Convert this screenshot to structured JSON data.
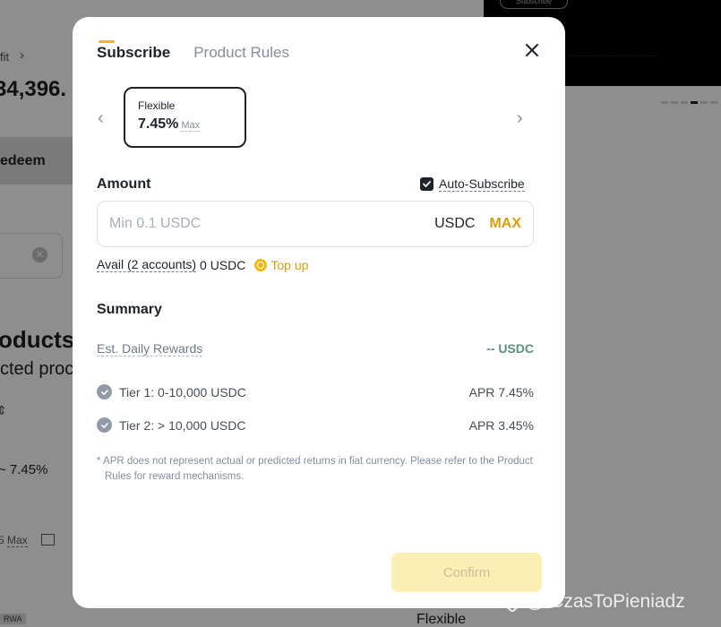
{
  "background": {
    "banner_button": "Subscribe",
    "banner_text": "·· ·· ······ ······ ······ ····· ···· ······ ···· ····· ······",
    "breadcrumb": "fit",
    "balance": "34,396.",
    "redeem_label": "edeem",
    "products_heading": "oducts",
    "selected_products": "cted proc",
    "apr_range": "~ 7.45%",
    "max_label": "Max",
    "max_prefix": "5",
    "rwa_tag": "RWA",
    "flexible_bottom": "Flexible"
  },
  "watermark": "@ CzasToPieniadz",
  "modal": {
    "tabs": [
      {
        "label": "Subscribe",
        "active": true
      },
      {
        "label": "Product Rules",
        "active": false
      }
    ],
    "product_card": {
      "label": "Flexible",
      "apr": "7.45%",
      "max": "Max"
    },
    "amount_label": "Amount",
    "auto_subscribe": {
      "label": "Auto-Subscribe",
      "checked": true
    },
    "amount_input": {
      "placeholder": "Min 0.1 USDC",
      "value": "",
      "unit": "USDC",
      "max_label": "MAX"
    },
    "avail": {
      "label": "Avail (2 accounts)",
      "value": "0 USDC",
      "topup_label": "Top up"
    },
    "summary_label": "Summary",
    "daily_rewards": {
      "label": "Est. Daily Rewards",
      "value": "-- USDC"
    },
    "tiers": [
      {
        "name": "Tier 1: 0-10,000 USDC",
        "rate": "APR 7.45%"
      },
      {
        "name": "Tier 2: > 10,000 USDC",
        "rate": "APR 3.45%"
      }
    ],
    "note": "* APR does not represent actual or predicted returns in fiat currency. Please refer to the Product Rules for reward mechanisms.",
    "confirm_label": "Confirm"
  },
  "colors": {
    "accent": "#f0b90b",
    "max_text": "#d4a012",
    "rewards_value": "#5e8f79",
    "confirm_disabled_bg": "#fcefb3"
  },
  "icons": [
    "close-icon",
    "chevron-left-icon",
    "chevron-right-icon",
    "checkbox-checked-icon",
    "topup-coin-icon",
    "check-circle-icon"
  ]
}
